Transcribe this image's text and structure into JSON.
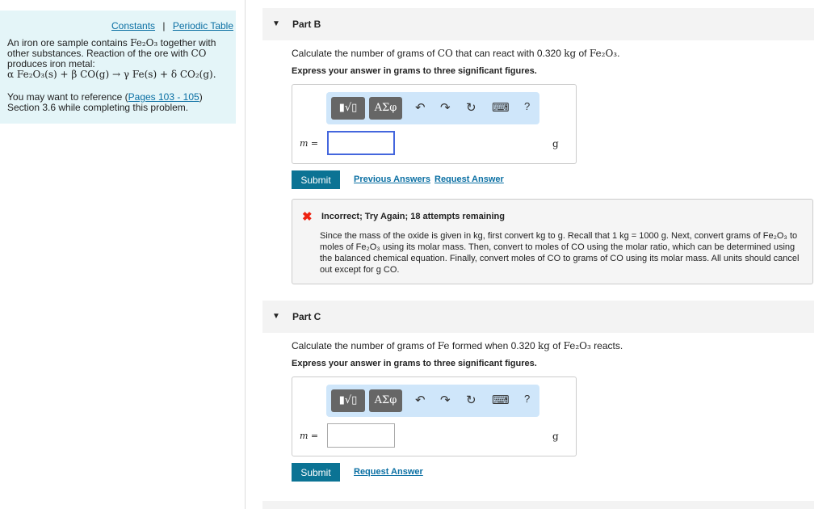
{
  "left": {
    "constants": "Constants",
    "sep": "|",
    "periodic": "Periodic Table",
    "intro1": "An iron ore sample contains ",
    "fe2o3": "Fe₂O₃",
    "intro2": " together with other substances. Reaction of the ore with ",
    "co": "CO",
    "intro3": " produces iron metal:",
    "equation": "α Fe₂O₃(s) + β CO(g) → γ Fe(s) + δ CO₂(g).",
    "ref1": "You may want to reference (",
    "pages": "Pages 103 - 105",
    "ref2": ") Section 3.6 while completing this problem."
  },
  "partB": {
    "title": "Part B",
    "q1": "Calculate the number of grams of ",
    "co": "CO",
    "q2": " that can react with 0.320 ",
    "kg": "kg",
    "q3": " of ",
    "fe2o3": "Fe₂O₃",
    "q4": ".",
    "instr": "Express your answer in grams to three significant figures.",
    "var": "m =",
    "unit": "g",
    "input_value": "",
    "submit": "Submit",
    "prev": "Previous Answers",
    "request": "Request Answer"
  },
  "toolbar": {
    "templates": "▮√▯",
    "greek": "ΑΣφ",
    "undo": "↶",
    "redo": "↷",
    "reset": "↻",
    "keyboard": "⌨",
    "help": "?"
  },
  "feedback": {
    "title": "Incorrect; Try Again; 18 attempts remaining",
    "text": "Since the mass of the oxide is given in kg, first convert kg to g. Recall that 1 kg = 1000 g. Next, convert grams of Fe₂O₃ to moles of Fe₂O₃ using its molar mass. Then, convert to moles of CO using the molar ratio, which can be determined using the balanced chemical equation. Finally, convert moles of CO to grams of CO using its molar mass. All units should cancel out except for g CO."
  },
  "partC": {
    "title": "Part C",
    "q1": "Calculate the number of grams of ",
    "fe": "Fe",
    "q2": " formed when 0.320 ",
    "kg": "kg",
    "q3": " of ",
    "fe2o3": "Fe₂O₃",
    "q4": " reacts.",
    "instr": "Express your answer in grams to three significant figures.",
    "var": "m =",
    "unit": "g",
    "input_value": "",
    "submit": "Submit",
    "request": "Request Answer"
  }
}
